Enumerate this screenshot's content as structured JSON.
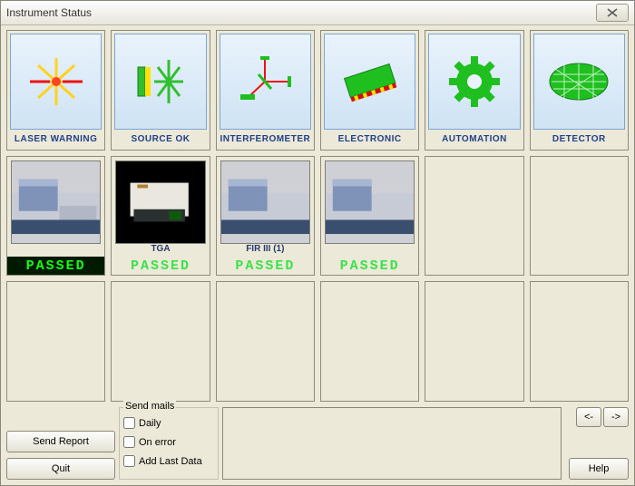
{
  "window": {
    "title": "Instrument Status"
  },
  "status": [
    {
      "id": "laser",
      "label": "LASER WARNING"
    },
    {
      "id": "source",
      "label": "SOURCE OK"
    },
    {
      "id": "interferometer",
      "label": "INTERFEROMETER"
    },
    {
      "id": "electronic",
      "label": "ELECTRONIC"
    },
    {
      "id": "automation",
      "label": "AUTOMATION"
    },
    {
      "id": "detector",
      "label": "DETECTOR"
    }
  ],
  "instruments": [
    {
      "id": "inst0",
      "name": "",
      "result": "PASSED",
      "result_style": "dark",
      "kind": "spectrometer"
    },
    {
      "id": "inst1",
      "name": "TGA",
      "result": "PASSED",
      "result_style": "light",
      "kind": "tga"
    },
    {
      "id": "inst2",
      "name": "FIR III (1)",
      "result": "PASSED",
      "result_style": "light",
      "kind": "spectrometer"
    },
    {
      "id": "inst3",
      "name": "",
      "result": "PASSED",
      "result_style": "light",
      "kind": "spectrometer"
    }
  ],
  "buttons": {
    "send_report": "Send Report",
    "quit": "Quit",
    "help": "Help",
    "prev": "<-",
    "next": "->"
  },
  "mails": {
    "legend": "Send mails",
    "daily": "Daily",
    "on_error": "On error",
    "add_last_data": "Add Last Data",
    "daily_checked": false,
    "on_error_checked": false,
    "add_last_data_checked": false
  }
}
